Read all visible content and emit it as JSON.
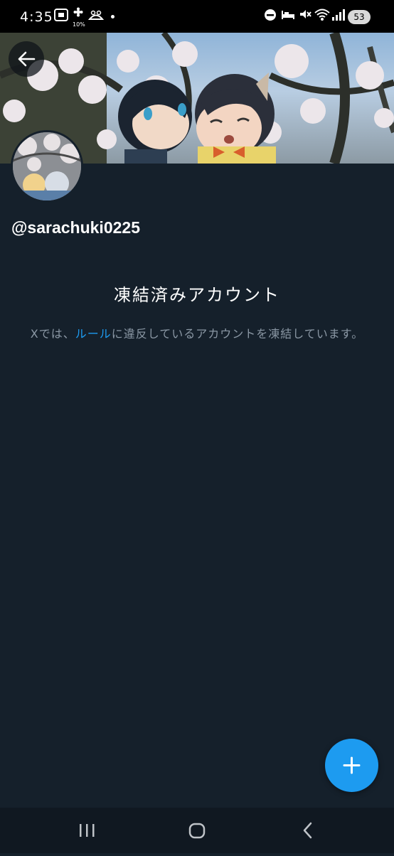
{
  "status_bar": {
    "time": "4:35",
    "app_icon_pct": "10%",
    "battery": "53"
  },
  "header": {
    "back_label": "Back"
  },
  "profile": {
    "handle": "@sarachuki0225"
  },
  "suspended": {
    "title": "凍結済みアカウント",
    "desc_prefix": "Xでは、",
    "desc_link": "ルール",
    "desc_suffix": "に違反しているアカウントを凍結しています。"
  },
  "colors": {
    "background": "#15202b",
    "accent": "#1d9bf0",
    "muted_text": "#8b98a5"
  },
  "icons": {
    "back": "arrow-left-icon",
    "compose": "plus-icon",
    "recents": "recents-icon",
    "home": "home-icon",
    "nav_back": "chevron-left-icon"
  }
}
